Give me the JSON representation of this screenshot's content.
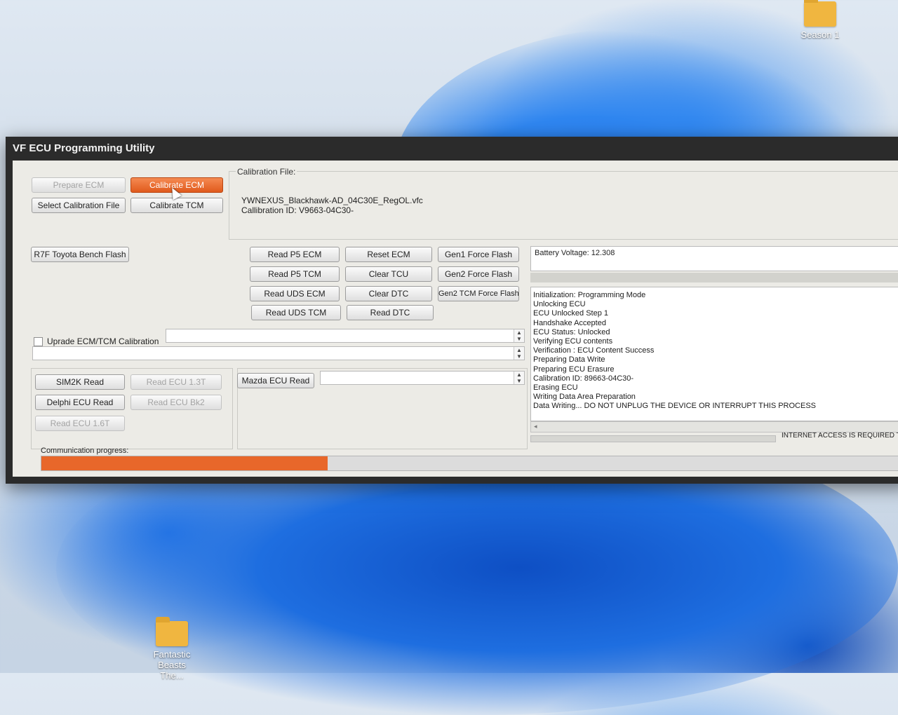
{
  "desktop": {
    "icons": [
      {
        "label": "Season 1"
      },
      {
        "label": "Fantastic Beasts The..."
      }
    ]
  },
  "window": {
    "title": "VF ECU Programming Utility"
  },
  "top_buttons": {
    "prepare_ecm": "Prepare ECM",
    "calibrate_ecm": "Calibrate ECM",
    "select_calibration_file": "Select Calibration File",
    "calibrate_tcm": "Calibrate TCM"
  },
  "calibration_file": {
    "label": "Calibration File:",
    "filename": "YWNEXUS_Blackhawk-AD_04C30E_RegOL.vfc",
    "id_line": "Callibration ID: V9663-04C30-"
  },
  "bench_flash": "R7F Toyota Bench Flash",
  "grid_buttons": {
    "read_p5_ecm": "Read P5 ECM",
    "reset_ecm": "Reset ECM",
    "gen1_force_flash": "Gen1 Force Flash",
    "read_p5_tcm": "Read P5 TCM",
    "clear_tcu": "Clear TCU",
    "gen2_force_flash": "Gen2 Force Flash",
    "read_uds_ecm": "Read UDS ECM",
    "clear_dtc": "Clear DTC",
    "gen2_tcm_force_flash": "Gen2 TCM Force Flash",
    "read_uds_tcm": "Read UDS TCM",
    "read_dtc": "Read DTC"
  },
  "upgrade": {
    "checkbox_label": "Uprade ECM/TCM Calibration",
    "checked": false
  },
  "bottom_buttons": {
    "sim2k_read": "SIM2K Read",
    "read_ecu_13t": "Read ECU 1.3T",
    "delphi_ecu_read": "Delphi ECU Read",
    "read_ecu_bk2": "Read ECU Bk2",
    "read_ecu_16t": "Read ECU 1.6T",
    "mazda_ecu_read": "Mazda ECU Read"
  },
  "battery": {
    "text": "Battery Voltage: 12.308"
  },
  "log": {
    "lines": [
      "Initialization: Programming Mode",
      "Unlocking ECU",
      "ECU Unlocked Step 1",
      "Handshake Accepted",
      "ECU Status: Unlocked",
      "Verifying ECU contents",
      "Verification : ECU Content Success",
      "Preparing Data Write",
      "Preparing ECU Erasure",
      "Calibration ID: 89663-04C30-",
      "Erasing ECU",
      "Writing Data Area Preparation",
      "Data Writing... DO NOT UNPLUG THE DEVICE OR INTERRUPT THIS PROCESS"
    ]
  },
  "status_notice": "INTERNET ACCESS IS REQUIRED TO",
  "progress": {
    "label": "Communication progress:",
    "fraction": 0.33
  },
  "colors": {
    "accent": "#e8672a",
    "window_frame": "#2b2b2b",
    "panel": "#ecebe6"
  }
}
